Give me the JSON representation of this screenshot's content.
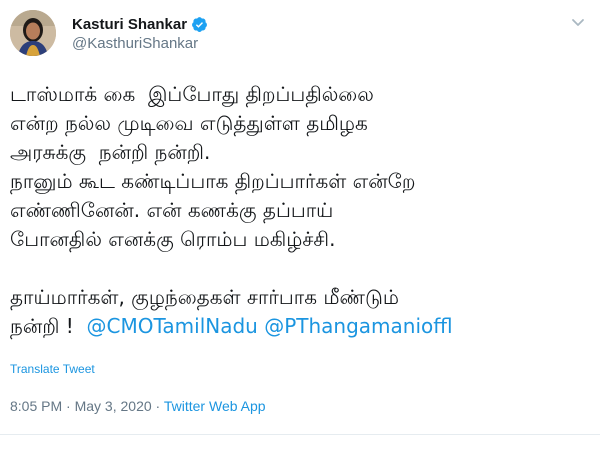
{
  "author": {
    "display_name": "Kasturi Shankar",
    "handle": "@KasthuriShankar",
    "verified": true
  },
  "tweet": {
    "lines": [
      "டாஸ்மாக் கை  இப்போது திறப்பதில்லை",
      "என்ற நல்ல முடிவை எடுத்துள்ள தமிழக",
      "அரசுக்கு  நன்றி நன்றி.",
      "நானும் கூட கண்டிப்பாக திறப்பார்கள் என்றே",
      "எண்ணினேன். என் கணக்கு தப்பாய்",
      "போனதில் எனக்கு ரொம்ப மகிழ்ச்சி.",
      "",
      "தாய்மார்கள், குழந்தைகள் சார்பாக மீண்டும்"
    ],
    "last_line_prefix": "நன்றி !  ",
    "mentions": [
      "@CMOTamilNadu",
      "@PThangamanioffl"
    ]
  },
  "translate_label": "Translate Tweet",
  "meta": {
    "time": "8:05 PM",
    "separator": " · ",
    "date": "May 3, 2020",
    "source": "Twitter Web App"
  },
  "colors": {
    "link": "#1b95e0",
    "text": "#14171a",
    "muted": "#657786",
    "divider": "#e6ecf0"
  },
  "icons": {
    "verified": "verified-badge-icon",
    "caret": "chevron-down-icon"
  }
}
